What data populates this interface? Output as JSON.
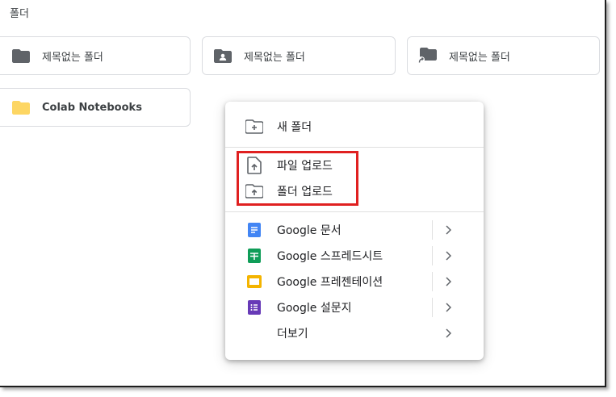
{
  "section": {
    "title": "폴더"
  },
  "folders": [
    {
      "name": "제목없는 폴더",
      "icon": "folder-icon"
    },
    {
      "name": "제목없는 폴더",
      "icon": "shared-folder-icon"
    },
    {
      "name": "제목없는 폴더",
      "icon": "folder-shortcut-icon"
    },
    {
      "name": "Colab Notebooks",
      "icon": "folder-yellow-icon"
    }
  ],
  "menu": {
    "new_folder": "새 폴더",
    "file_upload": "파일 업로드",
    "folder_upload": "폴더 업로드",
    "google_docs": "Google 문서",
    "google_sheets": "Google 스프레드시트",
    "google_slides": "Google 프레젠테이션",
    "google_forms": "Google 설문지",
    "more": "더보기"
  },
  "colors": {
    "folder_gray": "#5f6368",
    "folder_yellow": "#fdd663",
    "docs_blue": "#4285f4",
    "sheets_green": "#0f9d58",
    "slides_yellow": "#f4b400",
    "forms_purple": "#673ab7",
    "highlight_red": "#e02020"
  }
}
